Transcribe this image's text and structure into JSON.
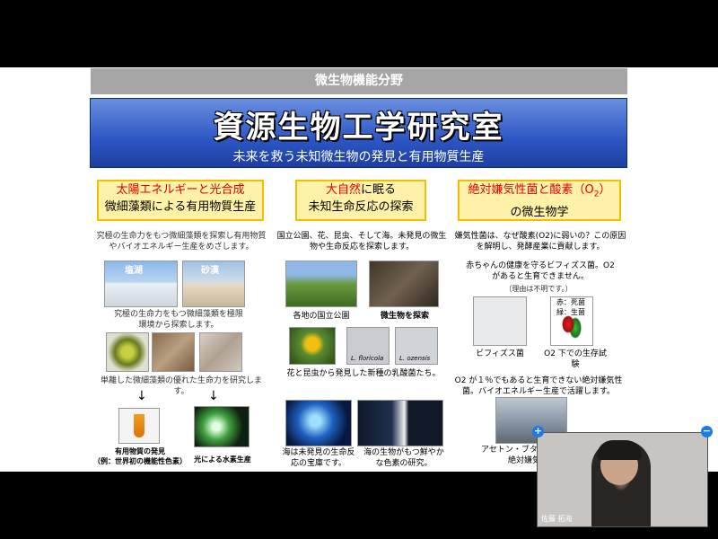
{
  "header": {
    "category": "微生物機能分野"
  },
  "banner": {
    "title": "資源生物工学研究室",
    "subtitle": "未来を救う未知微生物の発見と有用物質生産"
  },
  "col1": {
    "box_line1": "太陽エネルギーと光合成",
    "box_line2": "微細藻類による有用物質生産",
    "desc": "究極の生命力をもつ微細藻類を探索し有用物質やバイオエネルギー生産をめざします。",
    "photo1_label": "塩湖",
    "photo2_label": "砂漠",
    "caption1": "究極の生命力をもつ微細藻類を極限環境から探索します。",
    "caption2": "単離した微細藻類の優れた生命力を研究します。",
    "arrow": "↓",
    "result1": "有用物質の発見",
    "result1_sub": "（例：世界初の機能性色素）",
    "result2": "光による水素生産"
  },
  "col2": {
    "box_line1_red": "大自然",
    "box_line1_rest": "に眠る",
    "box_line2": "未知生命反応の探索",
    "desc": "国立公園、花、昆虫、そして海。未発見の微生物や生命反応を探索します。",
    "caption_park": "各地の国立公園",
    "caption_search": "微生物を探索",
    "label_a": "L. floricola",
    "label_b": "L. ozensis",
    "caption_bac": "花と昆虫から発見した新種の乳酸菌たち。",
    "caption_sea": "海は未発見の生命反応の宝庫です。",
    "caption_color": "海の生物がもつ鮮やかな色素の研究。"
  },
  "col3": {
    "box_line1": "絶対嫌気性菌と酸素（O",
    "box_sub": "2",
    "box_line1_end": "）",
    "box_line2": "の微生物学",
    "desc": "嫌気性菌は、なぜ酸素(O2)に弱いの？この原因を解明し、発酵産業に貢献します。",
    "baby": "赤ちゃんの健康を守るビフィズス菌。O2 があると生育できません。",
    "reason": "（理由は不明です。）",
    "legend_red": "赤：死菌",
    "legend_green": "緑：生菌",
    "caption_bif": "ビフィズス菌",
    "caption_test": "O2 下での生存試験",
    "anaerobe": "O2 が１％でもあると生育できない絶対嫌気性菌。バイオエネルギー生産で活躍します。",
    "acetone": "アセトン・ブタ",
    "acetone2": "絶対嫌気"
  },
  "video": {
    "participant_name": "佐藤 拓海",
    "plus": "+",
    "minus": "−"
  },
  "colors": {
    "banner_blue": "#2c56c4",
    "box_yellow": "#fff2a8",
    "red": "#e00000"
  }
}
